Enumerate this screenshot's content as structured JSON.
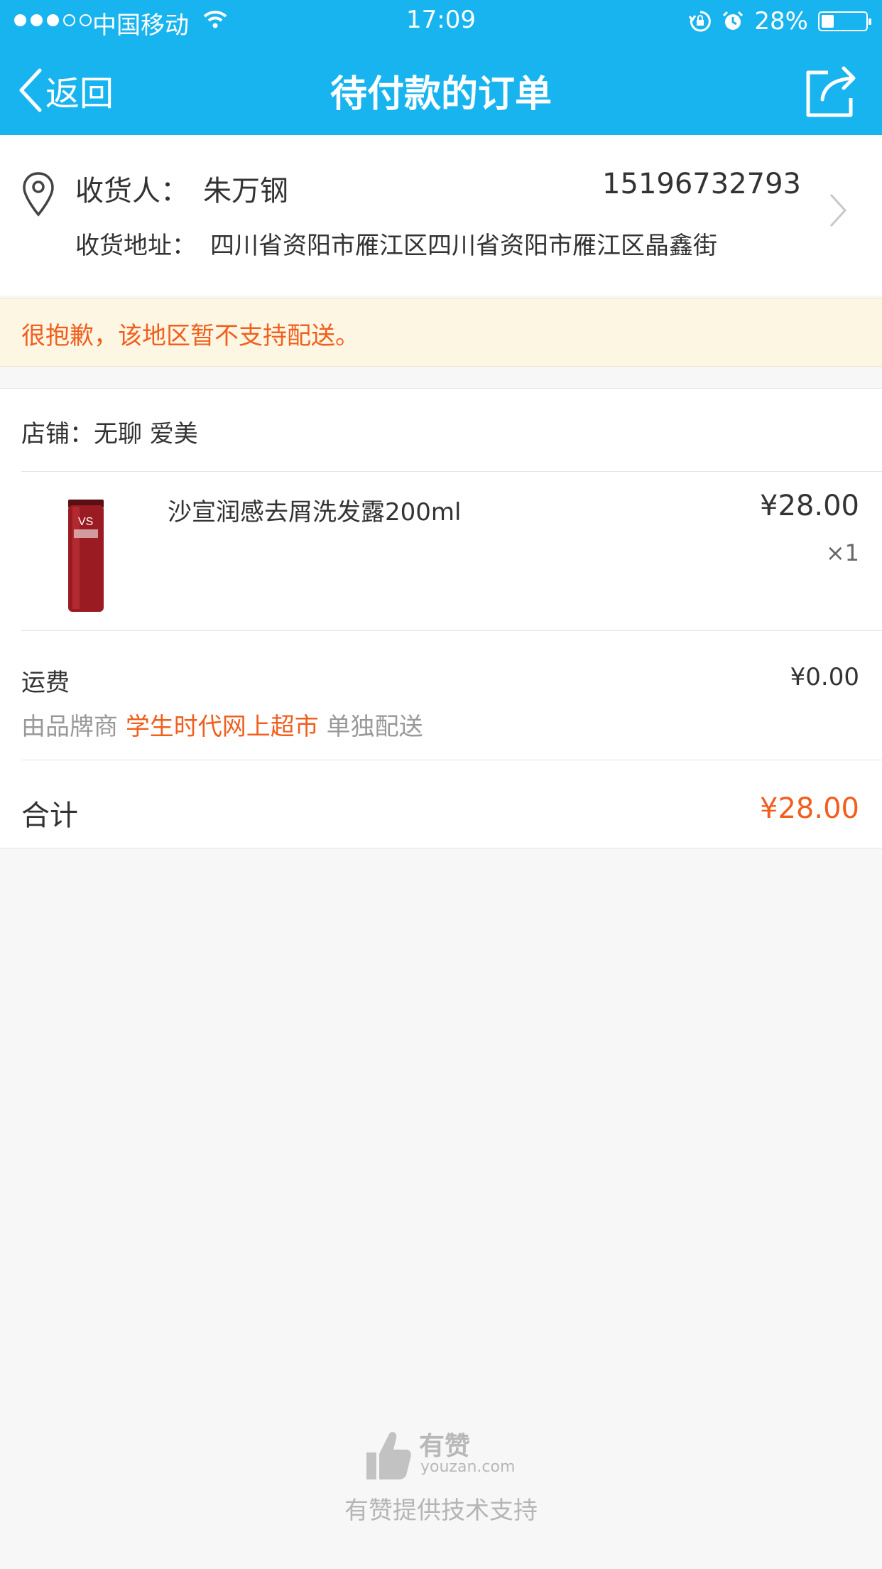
{
  "status_bar": {
    "carrier": "中国移动",
    "time": "17:09",
    "battery": "28%",
    "battery_level": 0.28
  },
  "nav": {
    "back_label": "返回",
    "title": "待付款的订单"
  },
  "address": {
    "recipient_label": "收货人：",
    "recipient_name": "朱万钢",
    "phone": "15196732793",
    "address_label": "收货地址：",
    "address_text": "四川省资阳市雁江区四川省资阳市雁江区晶鑫街"
  },
  "warning": "很抱歉，该地区暂不支持配送。",
  "order": {
    "shop": "店铺：无聊 爱美",
    "product_name": "沙宣润感去屑洗发露200ml",
    "price": "¥28.00",
    "quantity": "×1",
    "fee_label": "运费",
    "fee_value": "¥0.00",
    "ship_prefix": "由品牌商",
    "ship_brand": "学生时代网上超市",
    "ship_suffix": "单独配送",
    "total_label": "合计",
    "total_value": "¥28.00"
  },
  "footer": {
    "logo_cn": "有赞",
    "logo_en": "youzan.com",
    "powered_by": "有赞提供技术支持"
  },
  "colors": {
    "nav_bg": "#18b4ef",
    "accent_orange": "#f05f1e",
    "warning_bg": "#fdf6e3",
    "page_bg": "#f7f7f7"
  },
  "icons": [
    "location-pin-icon",
    "chevron-right-icon",
    "back-chevron-icon",
    "share-icon",
    "wifi-icon",
    "lock-rotation-icon",
    "alarm-icon",
    "battery-icon",
    "thumbs-up-logo-icon"
  ]
}
